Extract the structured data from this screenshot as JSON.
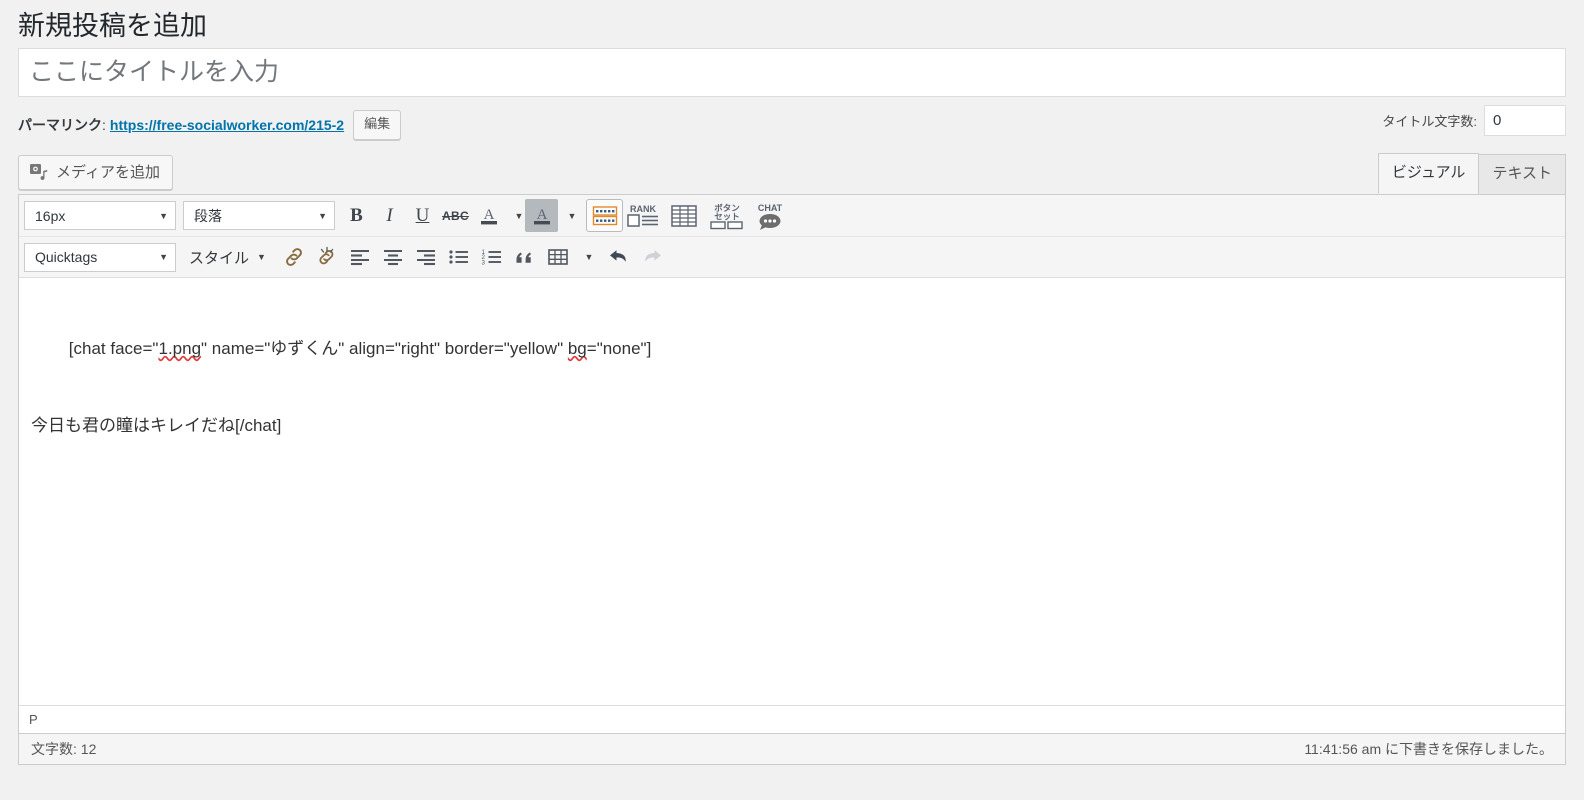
{
  "page": {
    "heading": "新規投稿を追加"
  },
  "title_field": {
    "value": "",
    "placeholder": "ここにタイトルを入力",
    "name": "post-title"
  },
  "permalink": {
    "label": "パーマリンク",
    "colon": ":",
    "url": "https://free-socialworker.com/215-2",
    "edit_button": "編集"
  },
  "title_counter": {
    "label": "タイトル文字数:",
    "value": "0"
  },
  "media": {
    "add_label": "メディアを追加",
    "icon": "add-media-icon"
  },
  "editor_tabs": [
    {
      "label": "ビジュアル",
      "active": true
    },
    {
      "label": "テキスト",
      "active": false
    }
  ],
  "toolbar": {
    "row1": {
      "font_size": {
        "value": "16px",
        "caret": "▼"
      },
      "format": {
        "value": "段落",
        "caret": "▼"
      },
      "bold": "B",
      "italic": "I",
      "underline": "U",
      "strikethrough": "ABC",
      "text_color": {
        "glyph": "A",
        "caret": "▼",
        "underline_color": "#464c52"
      },
      "background_color": {
        "glyph": "A",
        "caret": "▼",
        "underline_color": "#464c52",
        "active": true
      },
      "keyboard_icon": "keyboard-shortcuts-icon",
      "rank_label": "RANK",
      "table_icon": "table-grid-icon",
      "button_set_label_line1": "ボタン",
      "button_set_label_line2": "セット",
      "chat_label": "CHAT"
    },
    "row2": {
      "quicktags": {
        "value": "Quicktags",
        "caret": "▼"
      },
      "style": {
        "label": "スタイル",
        "caret": "▼"
      },
      "link": "insert-link-icon",
      "unlink": "remove-link-icon",
      "align_left": "align-left-icon",
      "align_center": "align-center-icon",
      "align_right": "align-right-icon",
      "bullet_list": "bullet-list-icon",
      "numbered_list": "numbered-list-icon",
      "blockquote": "blockquote-icon",
      "table": "table-icon",
      "table_caret": "▼",
      "undo": "undo-icon",
      "redo": "redo-icon"
    }
  },
  "content": {
    "line1_a": "[chat face=\"",
    "line1_spell1": "1.png",
    "line1_b": "\" name=\"ゆずくん\" align=\"right\" border=\"yellow\" ",
    "line1_spell2": "bg",
    "line1_c": "=\"none\"]",
    "line2": "今日も君の瞳はキレイだね[/chat]"
  },
  "path_bar": {
    "element": "P"
  },
  "status_bar": {
    "word_count": "文字数: 12",
    "save_status": "11:41:56 am に下書きを保存しました。"
  },
  "colors": {
    "page_bg": "#f1f1f1",
    "link": "#0073aa",
    "toolbar_bg": "#f5f5f5",
    "border": "#ccc",
    "spell_error": "#e03a3a",
    "active_btn_bg": "#b4b9be"
  }
}
